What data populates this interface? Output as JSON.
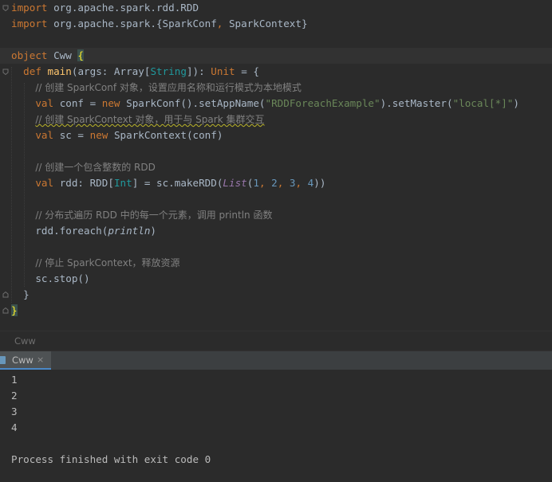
{
  "code_lines": [
    [
      {
        "c": "kw",
        "t": "import "
      },
      {
        "c": "cls",
        "t": "org.apache.spark.rdd.RDD"
      }
    ],
    [
      {
        "c": "kw",
        "t": "import "
      },
      {
        "c": "cls",
        "t": "org.apache.spark.{SparkConf"
      },
      {
        "c": "kw",
        "t": ", "
      },
      {
        "c": "cls",
        "t": "SparkContext}"
      }
    ],
    [],
    [
      {
        "c": "kw",
        "t": "object "
      },
      {
        "c": "cls",
        "t": "Cww "
      },
      {
        "c": "brace-hl",
        "t": "{"
      }
    ],
    [
      {
        "c": "cls",
        "t": "  "
      },
      {
        "c": "kw",
        "t": "def "
      },
      {
        "c": "fn",
        "t": "main"
      },
      {
        "c": "cls",
        "t": "(args: Array["
      },
      {
        "c": "tp",
        "t": "String"
      },
      {
        "c": "cls",
        "t": "]): "
      },
      {
        "c": "kw",
        "t": "Unit "
      },
      {
        "c": "cls",
        "t": "= {"
      }
    ],
    [
      {
        "c": "cls",
        "t": "    "
      },
      {
        "c": "cm",
        "t": "// 创建 SparkConf 对象，设置应用名称和运行模式为本地模式"
      }
    ],
    [
      {
        "c": "cls",
        "t": "    "
      },
      {
        "c": "kw",
        "t": "val "
      },
      {
        "c": "cls",
        "t": "conf = "
      },
      {
        "c": "kw",
        "t": "new "
      },
      {
        "c": "cls",
        "t": "SparkConf().setAppName("
      },
      {
        "c": "str",
        "t": "\"RDDForeachExample\""
      },
      {
        "c": "cls",
        "t": ").setMaster("
      },
      {
        "c": "str",
        "t": "\"local[*]\""
      },
      {
        "c": "cls",
        "t": ")"
      }
    ],
    [
      {
        "c": "cls",
        "t": "    "
      },
      {
        "c": "cm warn",
        "t": "// 创建 SparkContext 对象，用于与 Spark 集群交互"
      }
    ],
    [
      {
        "c": "cls",
        "t": "    "
      },
      {
        "c": "kw",
        "t": "val "
      },
      {
        "c": "cls",
        "t": "sc = "
      },
      {
        "c": "kw",
        "t": "new "
      },
      {
        "c": "cls",
        "t": "SparkContext(conf)"
      }
    ],
    [],
    [
      {
        "c": "cls",
        "t": "    "
      },
      {
        "c": "cm",
        "t": "// 创建一个包含整数的 RDD"
      }
    ],
    [
      {
        "c": "cls",
        "t": "    "
      },
      {
        "c": "kw",
        "t": "val "
      },
      {
        "c": "cls",
        "t": "rdd: RDD["
      },
      {
        "c": "tp",
        "t": "Int"
      },
      {
        "c": "cls",
        "t": "] = sc.makeRDD("
      },
      {
        "c": "it",
        "t": "List"
      },
      {
        "c": "cls",
        "t": "("
      },
      {
        "c": "num",
        "t": "1"
      },
      {
        "c": "kw",
        "t": ", "
      },
      {
        "c": "num",
        "t": "2"
      },
      {
        "c": "kw",
        "t": ", "
      },
      {
        "c": "num",
        "t": "3"
      },
      {
        "c": "kw",
        "t": ", "
      },
      {
        "c": "num",
        "t": "4"
      },
      {
        "c": "cls",
        "t": "))"
      }
    ],
    [],
    [
      {
        "c": "cls",
        "t": "    "
      },
      {
        "c": "cm",
        "t": "// 分布式遍历 RDD 中的每一个元素，调用 println 函数"
      }
    ],
    [
      {
        "c": "cls",
        "t": "    rdd.foreach("
      },
      {
        "c": "itw",
        "t": "println"
      },
      {
        "c": "cls",
        "t": ")"
      }
    ],
    [],
    [
      {
        "c": "cls",
        "t": "    "
      },
      {
        "c": "cm",
        "t": "// 停止 SparkContext，释放资源"
      }
    ],
    [
      {
        "c": "cls",
        "t": "    sc.stop()"
      }
    ],
    [
      {
        "c": "cls",
        "t": "  }"
      }
    ],
    [
      {
        "c": "brace-hl",
        "t": "}"
      }
    ]
  ],
  "breadcrumb": "Cww",
  "run_tab": {
    "label": "Cww",
    "close": "×"
  },
  "console_output": [
    "1",
    "2",
    "3",
    "4",
    "",
    "Process finished with exit code 0"
  ]
}
